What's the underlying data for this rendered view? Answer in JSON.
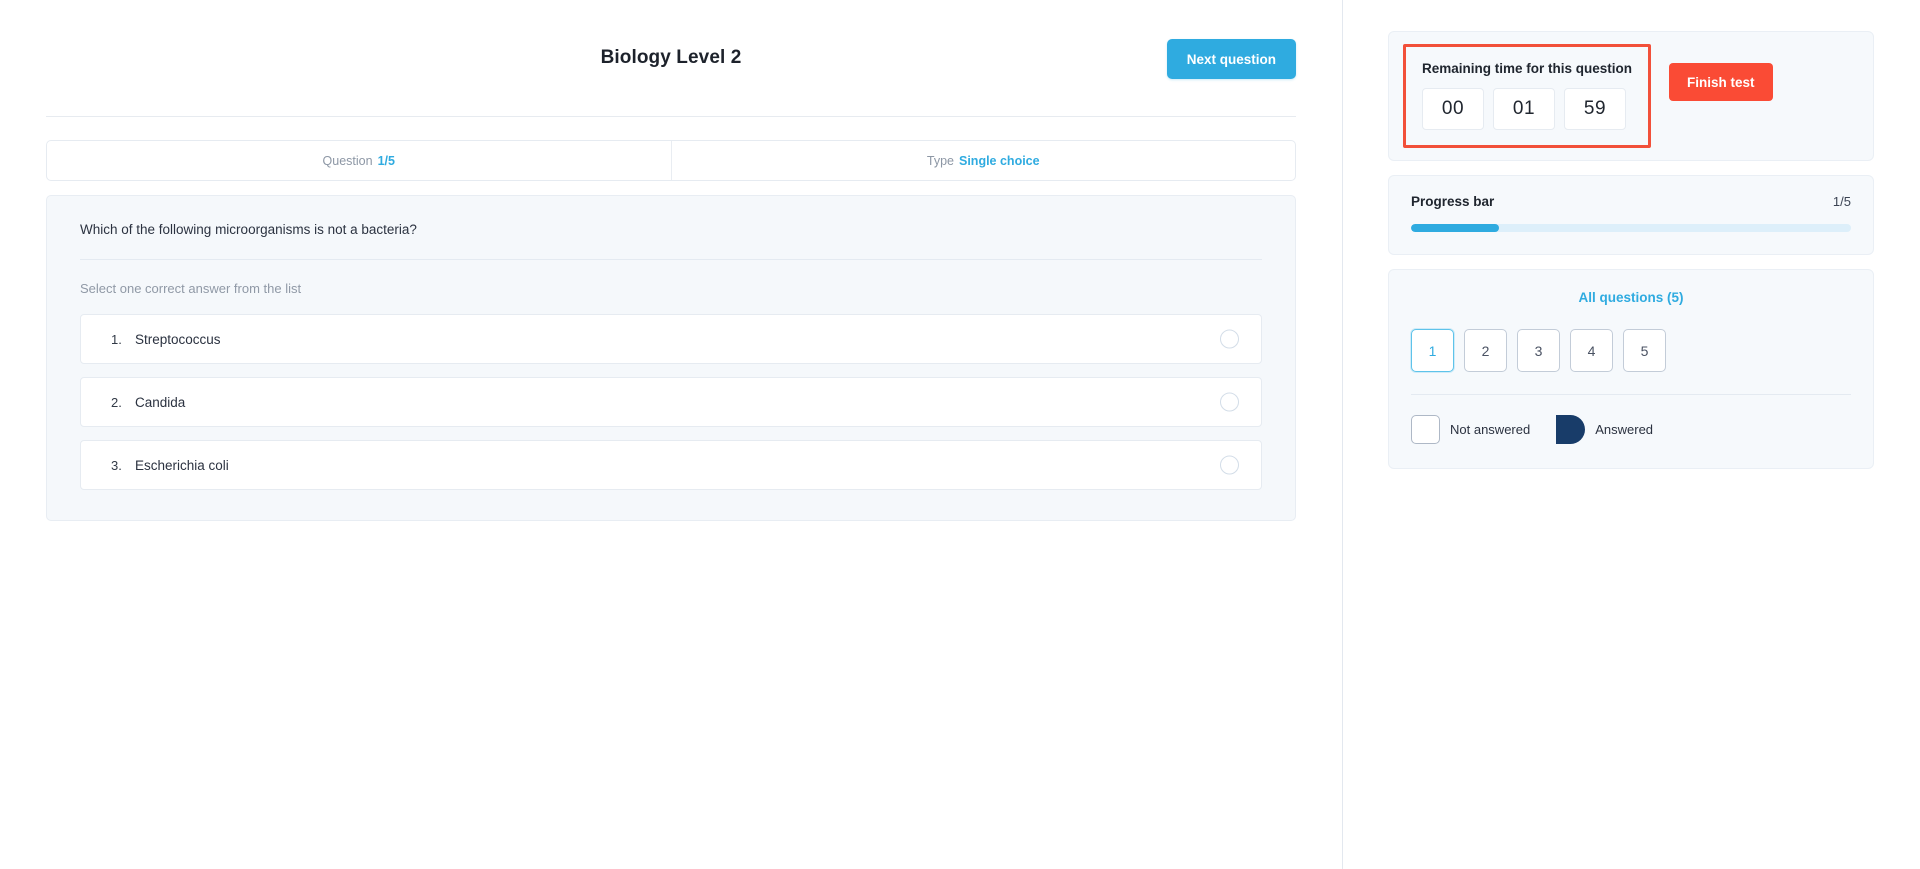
{
  "header": {
    "quiz_title": "Biology Level 2",
    "next_button": "Next question"
  },
  "meta": {
    "question_label": "Question",
    "question_value": "1/5",
    "type_label": "Type",
    "type_value": "Single choice"
  },
  "question": {
    "text": "Which of the following microorganisms is not a bacteria?",
    "hint": "Select one correct answer from the list",
    "answers": [
      {
        "number": "1.",
        "label": "Streptococcus",
        "selected": false
      },
      {
        "number": "2.",
        "label": "Candida",
        "selected": false
      },
      {
        "number": "3.",
        "label": "Escherichia coli",
        "selected": false
      }
    ]
  },
  "timer": {
    "label": "Remaining time for this question",
    "hours": "00",
    "minutes": "01",
    "seconds": "59",
    "finish_button": "Finish test",
    "highlight_color": "#f2503a"
  },
  "progress": {
    "title": "Progress bar",
    "count": "1/5",
    "percent": 20,
    "fill_color": "#2fabe0",
    "track_color": "#ddeffa"
  },
  "navigation": {
    "all_questions": "All questions (5)",
    "numbers": [
      {
        "label": "1",
        "current": true
      },
      {
        "label": "2",
        "current": false
      },
      {
        "label": "3",
        "current": false
      },
      {
        "label": "4",
        "current": false
      },
      {
        "label": "5",
        "current": false
      }
    ],
    "legend": [
      {
        "label": "Not answered",
        "style": "empty"
      },
      {
        "label": "Answered",
        "style": "filled"
      }
    ]
  },
  "colors": {
    "accent_blue": "#2fabe0",
    "danger_red": "#fa4b35",
    "answered_navy": "#183c69"
  }
}
